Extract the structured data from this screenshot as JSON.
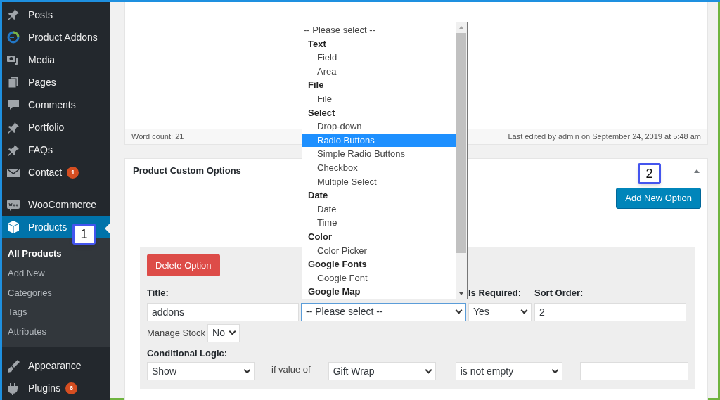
{
  "sidebar": {
    "items": [
      {
        "label": "Posts",
        "selected": false
      },
      {
        "label": "Product Addons",
        "selected": false
      },
      {
        "label": "Media",
        "selected": false
      },
      {
        "label": "Pages",
        "selected": false
      },
      {
        "label": "Comments",
        "selected": false
      },
      {
        "label": "Portfolio",
        "selected": false
      },
      {
        "label": "FAQs",
        "selected": false
      },
      {
        "label": "Contact",
        "selected": false,
        "badge": "1"
      },
      {
        "label": "WooCommerce",
        "selected": false
      },
      {
        "label": "Products",
        "selected": true,
        "children": [
          {
            "label": "All Products",
            "selected": true
          },
          {
            "label": "Add New",
            "selected": false
          },
          {
            "label": "Categories",
            "selected": false
          },
          {
            "label": "Tags",
            "selected": false
          },
          {
            "label": "Attributes",
            "selected": false
          }
        ]
      },
      {
        "label": "Appearance",
        "selected": false
      },
      {
        "label": "Plugins",
        "selected": false,
        "badge": "6"
      }
    ]
  },
  "editor": {
    "word_count": "Word count: 21",
    "last_edited": "Last edited by admin on September 24, 2019 at 5:48 am"
  },
  "options_box": {
    "title": "Product Custom Options",
    "expanded": true,
    "add_button": "Add New Option",
    "option": {
      "delete_button": "Delete Option",
      "title_label": "Title:",
      "title_value": "addons",
      "type_select": {
        "value": "-- Please select --",
        "open": true,
        "options": [
          {
            "kind": "option",
            "label": "-- Please select --",
            "highlighted": false
          },
          {
            "kind": "group",
            "label": "Text"
          },
          {
            "kind": "option",
            "label": "Field",
            "highlighted": false
          },
          {
            "kind": "option",
            "label": "Area",
            "highlighted": false
          },
          {
            "kind": "group",
            "label": "File"
          },
          {
            "kind": "option",
            "label": "File",
            "highlighted": false
          },
          {
            "kind": "group",
            "label": "Select"
          },
          {
            "kind": "option",
            "label": "Drop-down",
            "highlighted": false
          },
          {
            "kind": "option",
            "label": "Radio Buttons",
            "highlighted": true
          },
          {
            "kind": "option",
            "label": "Simple Radio Buttons",
            "highlighted": false
          },
          {
            "kind": "option",
            "label": "Checkbox",
            "highlighted": false
          },
          {
            "kind": "option",
            "label": "Multiple Select",
            "highlighted": false
          },
          {
            "kind": "group",
            "label": "Date"
          },
          {
            "kind": "option",
            "label": "Date",
            "highlighted": false
          },
          {
            "kind": "option",
            "label": "Time",
            "highlighted": false
          },
          {
            "kind": "group",
            "label": "Color"
          },
          {
            "kind": "option",
            "label": "Color Picker",
            "highlighted": false
          },
          {
            "kind": "group",
            "label": "Google Fonts"
          },
          {
            "kind": "option",
            "label": "Google Font",
            "highlighted": false
          },
          {
            "kind": "group",
            "label": "Google Map"
          }
        ]
      },
      "required_label": "Is Required:",
      "required_value": "Yes",
      "sort_label": "Sort Order:",
      "sort_value": "2",
      "manage_stock_label": "Manage Stock",
      "manage_stock_value": "No",
      "logic_label": "Conditional Logic:",
      "logic_action": "Show",
      "if_value_label": "if value of",
      "logic_field": "Gift Wrap",
      "logic_operator": "is not empty"
    }
  },
  "callouts": [
    {
      "label": "1"
    },
    {
      "label": "2"
    }
  ]
}
